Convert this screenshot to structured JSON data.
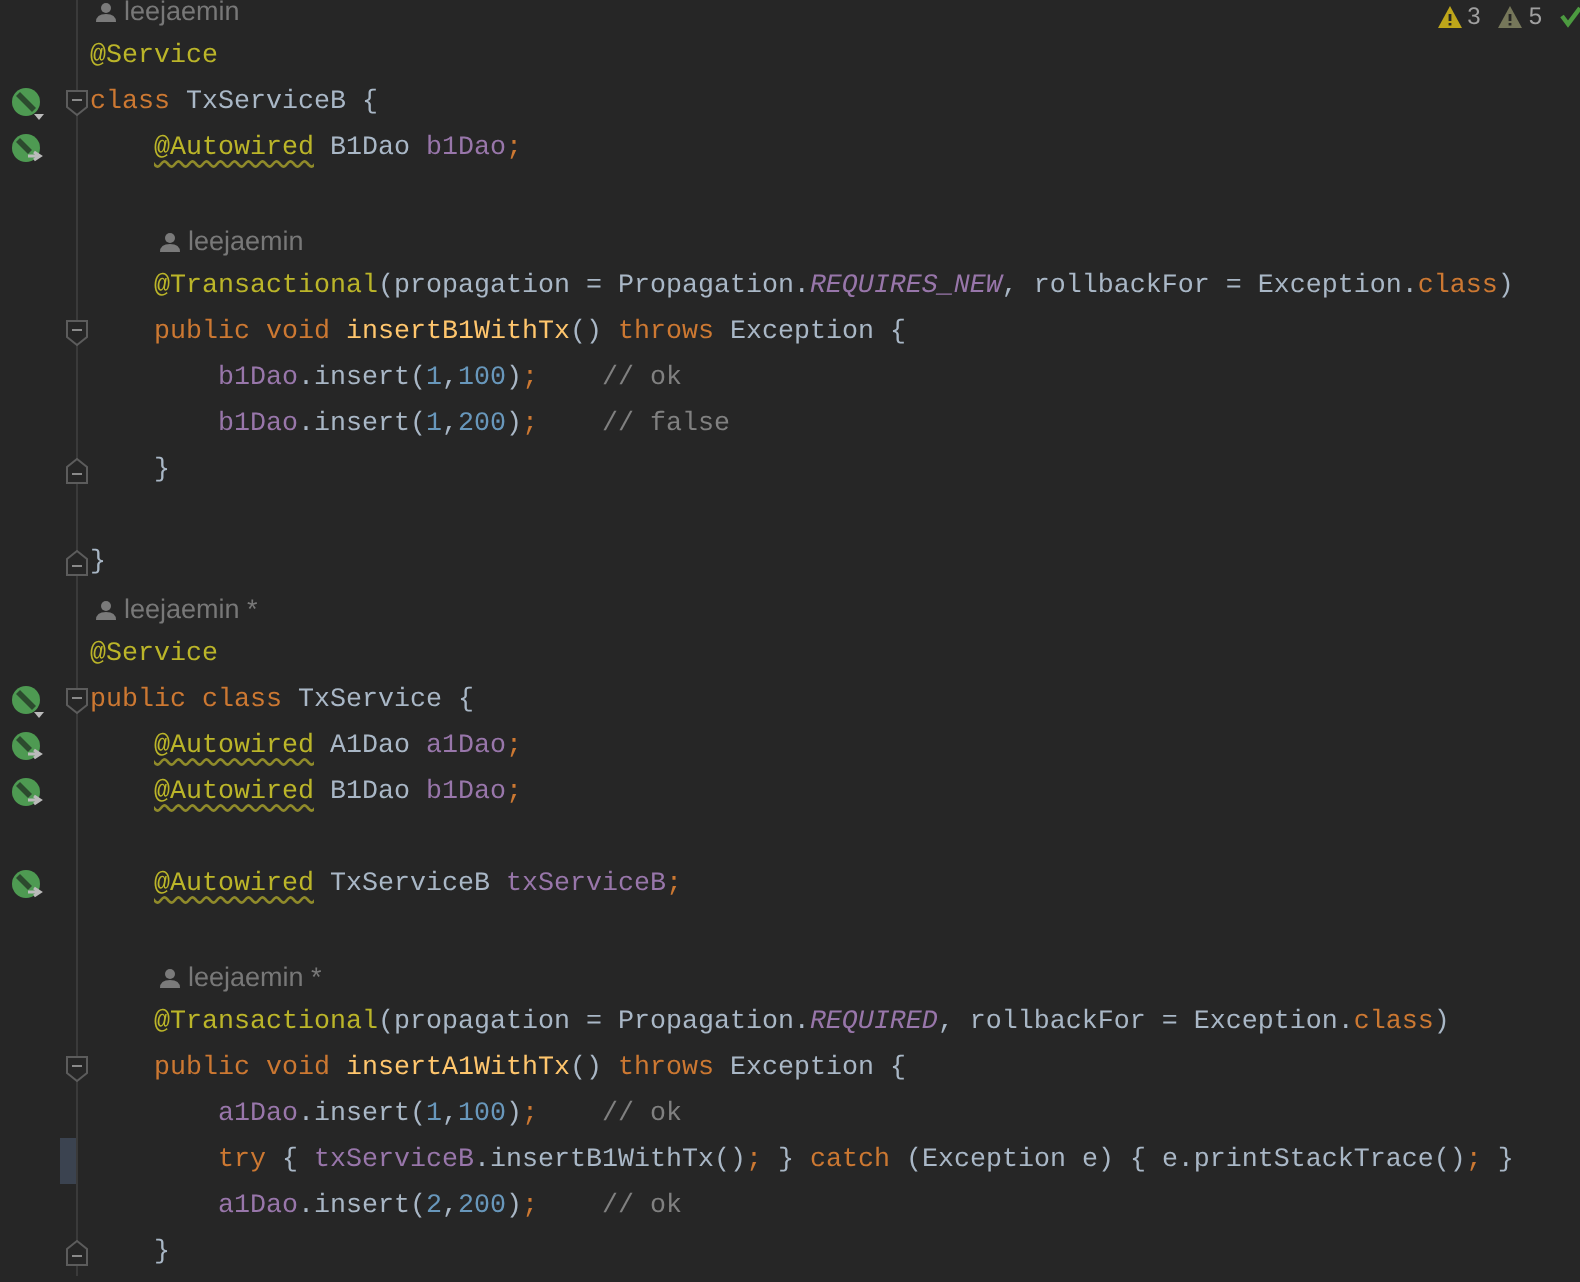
{
  "inspections": {
    "warnings": "3",
    "weak_warnings": "5"
  },
  "lines": [
    {
      "kind": "author",
      "name": "leejaemin",
      "modified": false
    },
    {
      "kind": "code",
      "modified": false,
      "tokens": [
        {
          "kind": "ann",
          "text": "@Service"
        }
      ]
    },
    {
      "kind": "code",
      "gutter": {
        "kind": "bean"
      },
      "fold": {
        "kind": "start"
      },
      "modified": false,
      "tokens": [
        {
          "kind": "kw",
          "text": "class "
        },
        {
          "kind": "plain",
          "text": "TxServiceB {"
        }
      ],
      "children": [
        {
          "kind": "code",
          "gutter": {
            "kind": "autowired"
          },
          "modified": false,
          "tokens": [
            {
              "kind": "ann-warn",
              "text": "@Autowired"
            },
            {
              "kind": "plain",
              "text": " B1Dao "
            },
            {
              "kind": "field",
              "text": "b1Dao"
            },
            {
              "kind": "kw",
              "text": ";"
            }
          ]
        },
        {
          "kind": "blank",
          "modified": false
        },
        {
          "kind": "author",
          "name": "leejaemin",
          "modified": false
        },
        {
          "kind": "code",
          "modified": false,
          "tokens": [
            {
              "kind": "ann",
              "text": "@Transactional"
            },
            {
              "kind": "plain",
              "text": "(propagation = Propagation."
            },
            {
              "kind": "const",
              "text": "REQUIRES_NEW"
            },
            {
              "kind": "plain",
              "text": ", rollbackFor = Exception."
            },
            {
              "kind": "kw",
              "text": "class"
            },
            {
              "kind": "plain",
              "text": ")"
            }
          ]
        },
        {
          "kind": "code",
          "fold": {
            "kind": "start"
          },
          "modified": false,
          "tokens": [
            {
              "kind": "kw",
              "text": "public void "
            },
            {
              "kind": "method",
              "text": "insertB1WithTx"
            },
            {
              "kind": "plain",
              "text": "() "
            },
            {
              "kind": "kw",
              "text": "throws "
            },
            {
              "kind": "plain",
              "text": "Exception {"
            }
          ],
          "children": [
            {
              "kind": "code",
              "modified": false,
              "tokens": [
                {
                  "kind": "field",
                  "text": "b1Dao"
                },
                {
                  "kind": "plain",
                  "text": ".insert("
                },
                {
                  "kind": "num",
                  "text": "1"
                },
                {
                  "kind": "plain",
                  "text": ","
                },
                {
                  "kind": "num",
                  "text": "100"
                },
                {
                  "kind": "plain",
                  "text": ")"
                },
                {
                  "kind": "kw",
                  "text": ";"
                },
                {
                  "kind": "comment",
                  "text": "    // ok"
                }
              ]
            },
            {
              "kind": "code",
              "modified": false,
              "tokens": [
                {
                  "kind": "field",
                  "text": "b1Dao"
                },
                {
                  "kind": "plain",
                  "text": ".insert("
                },
                {
                  "kind": "num",
                  "text": "1"
                },
                {
                  "kind": "plain",
                  "text": ","
                },
                {
                  "kind": "num",
                  "text": "200"
                },
                {
                  "kind": "plain",
                  "text": ")"
                },
                {
                  "kind": "kw",
                  "text": ";"
                },
                {
                  "kind": "comment",
                  "text": "    // false"
                }
              ]
            }
          ]
        },
        {
          "kind": "code",
          "fold": {
            "kind": "end"
          },
          "modified": false,
          "tokens": [
            {
              "kind": "plain",
              "text": "}"
            }
          ]
        },
        {
          "kind": "blank",
          "modified": false
        }
      ]
    },
    {
      "kind": "code",
      "fold": {
        "kind": "end"
      },
      "modified": false,
      "tokens": [
        {
          "kind": "plain",
          "text": "}"
        }
      ]
    },
    {
      "kind": "author",
      "name": "leejaemin *",
      "modified": false
    },
    {
      "kind": "code",
      "modified": false,
      "tokens": [
        {
          "kind": "ann",
          "text": "@Service"
        }
      ]
    },
    {
      "kind": "code",
      "gutter": {
        "kind": "bean"
      },
      "fold": {
        "kind": "start"
      },
      "modified": false,
      "tokens": [
        {
          "kind": "kw",
          "text": "public class "
        },
        {
          "kind": "plain",
          "text": "TxService {"
        }
      ],
      "children": [
        {
          "kind": "code",
          "gutter": {
            "kind": "autowired"
          },
          "modified": false,
          "tokens": [
            {
              "kind": "ann-warn",
              "text": "@Autowired"
            },
            {
              "kind": "plain",
              "text": " A1Dao "
            },
            {
              "kind": "field",
              "text": "a1Dao"
            },
            {
              "kind": "kw",
              "text": ";"
            }
          ]
        },
        {
          "kind": "code",
          "gutter": {
            "kind": "autowired"
          },
          "modified": false,
          "tokens": [
            {
              "kind": "ann-warn",
              "text": "@Autowired"
            },
            {
              "kind": "plain",
              "text": " B1Dao "
            },
            {
              "kind": "field",
              "text": "b1Dao"
            },
            {
              "kind": "kw",
              "text": ";"
            }
          ]
        },
        {
          "kind": "blank",
          "modified": false
        },
        {
          "kind": "code",
          "gutter": {
            "kind": "autowired"
          },
          "modified": false,
          "tokens": [
            {
              "kind": "ann-warn",
              "text": "@Autowired"
            },
            {
              "kind": "plain",
              "text": " TxServiceB "
            },
            {
              "kind": "field",
              "text": "txServiceB"
            },
            {
              "kind": "kw",
              "text": ";"
            }
          ]
        },
        {
          "kind": "blank",
          "modified": false
        },
        {
          "kind": "author",
          "name": "leejaemin *",
          "modified": false
        },
        {
          "kind": "code",
          "modified": false,
          "tokens": [
            {
              "kind": "ann",
              "text": "@Transactional"
            },
            {
              "kind": "plain",
              "text": "(propagation = Propagation."
            },
            {
              "kind": "const",
              "text": "REQUIRED"
            },
            {
              "kind": "plain",
              "text": ", rollbackFor = Exception."
            },
            {
              "kind": "kw",
              "text": "class"
            },
            {
              "kind": "plain",
              "text": ")"
            }
          ]
        },
        {
          "kind": "code",
          "fold": {
            "kind": "start"
          },
          "modified": false,
          "tokens": [
            {
              "kind": "kw",
              "text": "public void "
            },
            {
              "kind": "method",
              "text": "insertA1WithTx"
            },
            {
              "kind": "plain",
              "text": "() "
            },
            {
              "kind": "kw",
              "text": "throws "
            },
            {
              "kind": "plain",
              "text": "Exception {"
            }
          ],
          "children": [
            {
              "kind": "code",
              "modified": false,
              "tokens": [
                {
                  "kind": "field",
                  "text": "a1Dao"
                },
                {
                  "kind": "plain",
                  "text": ".insert("
                },
                {
                  "kind": "num",
                  "text": "1"
                },
                {
                  "kind": "plain",
                  "text": ","
                },
                {
                  "kind": "num",
                  "text": "100"
                },
                {
                  "kind": "plain",
                  "text": ")"
                },
                {
                  "kind": "kw",
                  "text": ";"
                },
                {
                  "kind": "comment",
                  "text": "    // ok"
                }
              ]
            },
            {
              "kind": "code",
              "modified": true,
              "tokens": [
                {
                  "kind": "kw",
                  "text": "try"
                },
                {
                  "kind": "plain",
                  "text": " { "
                },
                {
                  "kind": "field",
                  "text": "txServiceB"
                },
                {
                  "kind": "plain",
                  "text": ".insertB1WithTx()"
                },
                {
                  "kind": "kw",
                  "text": ";"
                },
                {
                  "kind": "plain",
                  "text": " } "
                },
                {
                  "kind": "kw",
                  "text": "catch"
                },
                {
                  "kind": "plain",
                  "text": " (Exception e) { e.printStackTrace()"
                },
                {
                  "kind": "kw",
                  "text": ";"
                },
                {
                  "kind": "plain",
                  "text": " }"
                }
              ]
            },
            {
              "kind": "code",
              "modified": false,
              "tokens": [
                {
                  "kind": "field",
                  "text": "a1Dao"
                },
                {
                  "kind": "plain",
                  "text": ".insert("
                },
                {
                  "kind": "num",
                  "text": "2"
                },
                {
                  "kind": "plain",
                  "text": ","
                },
                {
                  "kind": "num",
                  "text": "200"
                },
                {
                  "kind": "plain",
                  "text": ")"
                },
                {
                  "kind": "kw",
                  "text": ";"
                },
                {
                  "kind": "comment",
                  "text": "    // ok"
                }
              ]
            }
          ]
        },
        {
          "kind": "code",
          "fold": {
            "kind": "end"
          },
          "modified": false,
          "tokens": [
            {
              "kind": "plain",
              "text": "}"
            }
          ]
        }
      ]
    }
  ]
}
